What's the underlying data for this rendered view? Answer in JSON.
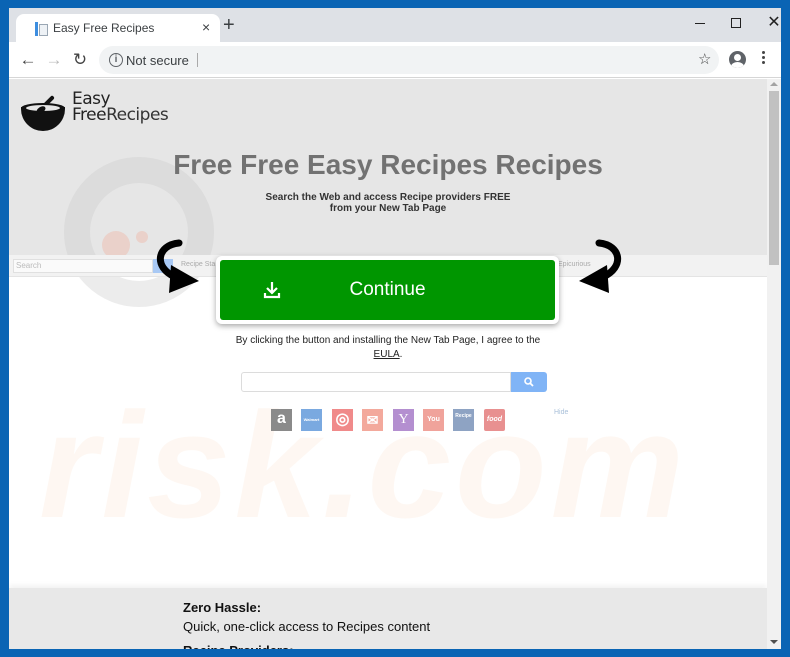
{
  "browser": {
    "tab_title": "Easy Free Recipes",
    "tab_close": "×",
    "new_tab": "+",
    "security_label": "Not secure",
    "icons": {
      "back": "arrow-left-icon",
      "forward": "arrow-right-icon",
      "reload": "reload-icon",
      "info": "info-icon",
      "bookmark": "star-icon",
      "profile": "account-icon",
      "menu": "kebab-menu-icon"
    },
    "glyphs": {
      "back": "←",
      "forward": "→",
      "reload": "↻",
      "info": "i",
      "star": "☆",
      "close": "✕"
    }
  },
  "page": {
    "logo": {
      "line1": "Easy",
      "line2a": "Free",
      "line2b": "Recipes"
    },
    "headline": "Free Free Easy Recipes Recipes",
    "subline1": "Search the Web and access Recipe providers FREE",
    "subline2": "from your New Tab Page",
    "background_preview": {
      "search_placeholder": "Search",
      "link1": "Recipe Sta",
      "link2": "Epicurious"
    },
    "cta": {
      "label": "Continue",
      "color": "#009600"
    },
    "agreement": {
      "text": "By clicking the button and installing the New Tab Page, I agree to the",
      "eula": "EULA",
      "trailing": "."
    },
    "newtab_search": {
      "value": "",
      "placeholder": ""
    },
    "hide_label": "Hide",
    "shortcuts": [
      {
        "name": "amazon",
        "glyph": "a",
        "color": "#8a8a8a"
      },
      {
        "name": "walmart",
        "glyph": "Walmart",
        "color": "#7aa9e0"
      },
      {
        "name": "target",
        "glyph": "◎",
        "color": "#f08a8a"
      },
      {
        "name": "gmail",
        "glyph": "✉",
        "color": "#f3a99c"
      },
      {
        "name": "yahoo",
        "glyph": "Y",
        "color": "#b48fd0"
      },
      {
        "name": "youtube",
        "glyph": "You",
        "color": "#f0a39b"
      },
      {
        "name": "recipes",
        "glyph": "Recipe",
        "color": "#8ea3c3"
      },
      {
        "name": "food-network",
        "glyph": "food",
        "color": "#e89090"
      }
    ],
    "features": {
      "title1": "Zero Hassle:",
      "desc1": "Quick, one-click access to Recipes content",
      "title2": "Recipe Providers:"
    },
    "watermark": "risk.com"
  }
}
